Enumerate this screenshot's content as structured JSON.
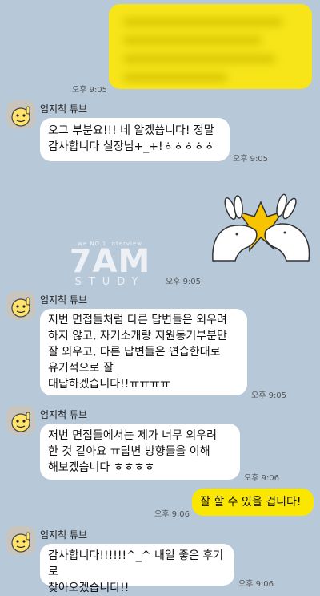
{
  "contact_name": "엄지척 튜브",
  "watermark": {
    "top": "we NO.1 interview",
    "main": "7AM",
    "sub": "STUDY"
  },
  "messages": [
    {
      "id": "m1",
      "side": "out",
      "blurred": true,
      "time": "오후 9:05"
    },
    {
      "id": "m2",
      "side": "in",
      "sender": "엄지척 튜브",
      "lines": [
        "오그 부분요!!! 네 알겠씁니다! 정말",
        "감사합니다 실장님+_+!ㅎㅎㅎㅎㅎ"
      ],
      "time": "오후 9:05"
    },
    {
      "id": "m3",
      "side": "out",
      "sticker": "high-five-rabbits-sticker",
      "time": "오후 9:05"
    },
    {
      "id": "m4",
      "side": "in",
      "sender": "엄지척 튜브",
      "lines": [
        "저번 면접들처럼 다른 답변들은 외우려",
        "하지 않고, 자기소개랑 지원동기부분만",
        "잘 외우고, 다른 답변들은 연습한대로",
        "유기적으로 잘",
        "대답하겠습니다!!ㅠㅠㅠㅠ"
      ],
      "time": "오후 9:05"
    },
    {
      "id": "m5",
      "side": "in",
      "sender": "엄지척 튜브",
      "lines": [
        "저번 면접들에서는 제가 너무 외우려",
        "한 것 같아요 ㅠ답변 방향들을 이해",
        "해보겠습니다 ㅎㅎㅎㅎ"
      ],
      "time": "오후 9:06"
    },
    {
      "id": "m6",
      "side": "out",
      "lines": [
        "잘 할 수 있을 겁니다!"
      ],
      "time": "오후 9:06"
    },
    {
      "id": "m7",
      "side": "in",
      "sender": "엄지척 튜브",
      "lines": [
        "감사합니다!!!!!!^_^ 내일 좋은 후기로",
        "찾아오겠습니다!!"
      ],
      "time": "오후 9:06"
    }
  ],
  "colors": {
    "background": "#b7c8d9",
    "outgoing_bubble": "#fbe600",
    "incoming_bubble": "#ffffff"
  }
}
